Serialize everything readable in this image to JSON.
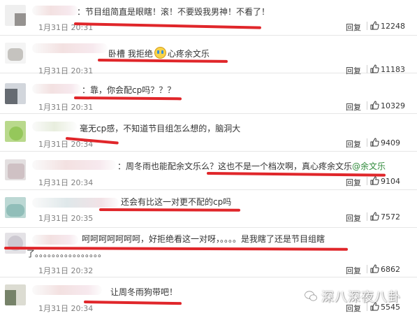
{
  "comments": [
    {
      "text": "：节目组简直是眼瞎！滚！不要毁我男神！不看了！",
      "time": "1月31日 20:31",
      "reply_label": "回复",
      "likes": "12248"
    },
    {
      "text_before": "卧槽 我拒绝",
      "text_after": "心疼余文乐",
      "emoji": "crying-face-emoji",
      "time": "1月31日 20:31",
      "reply_label": "回复",
      "likes": "11183"
    },
    {
      "text": "：靠，你会配cp吗？？？",
      "time": "1月31日 20:31",
      "reply_label": "回复",
      "likes": "10329"
    },
    {
      "text": "毫无cp感，不知道节目组怎么想的，脑洞大",
      "time": "1月31日 20:34",
      "reply_label": "回复",
      "likes": "9409"
    },
    {
      "text": "：周冬雨也能配余文乐么？这也不是一个档次啊，真心疼余文乐",
      "mention": "@余文乐",
      "time": "1月31日 20:34",
      "reply_label": "回复",
      "likes": "9104"
    },
    {
      "text": "还会有比这一对更不配的cp吗",
      "time": "1月31日 20:35",
      "reply_label": "回复",
      "likes": "7572"
    },
    {
      "text": "呵呵呵呵呵呵呵，好拒绝看这一对呀，。。。。是我瞎了还是节目组瞎",
      "continuation": "了。。。。。。。。。。。。。。。。",
      "time": "1月31日 20:32",
      "reply_label": "回复",
      "likes": "6862"
    },
    {
      "text": "让周冬雨狗带吧！",
      "time": "1月31日 20:34",
      "reply_label": "回复",
      "likes": "5545"
    }
  ],
  "watermark": {
    "text": "深八深夜八卦",
    "icon": "wechat-logo-icon"
  },
  "colors": {
    "scribble": "#e0262a",
    "mention": "#2f8a3a",
    "time": "#808080"
  }
}
